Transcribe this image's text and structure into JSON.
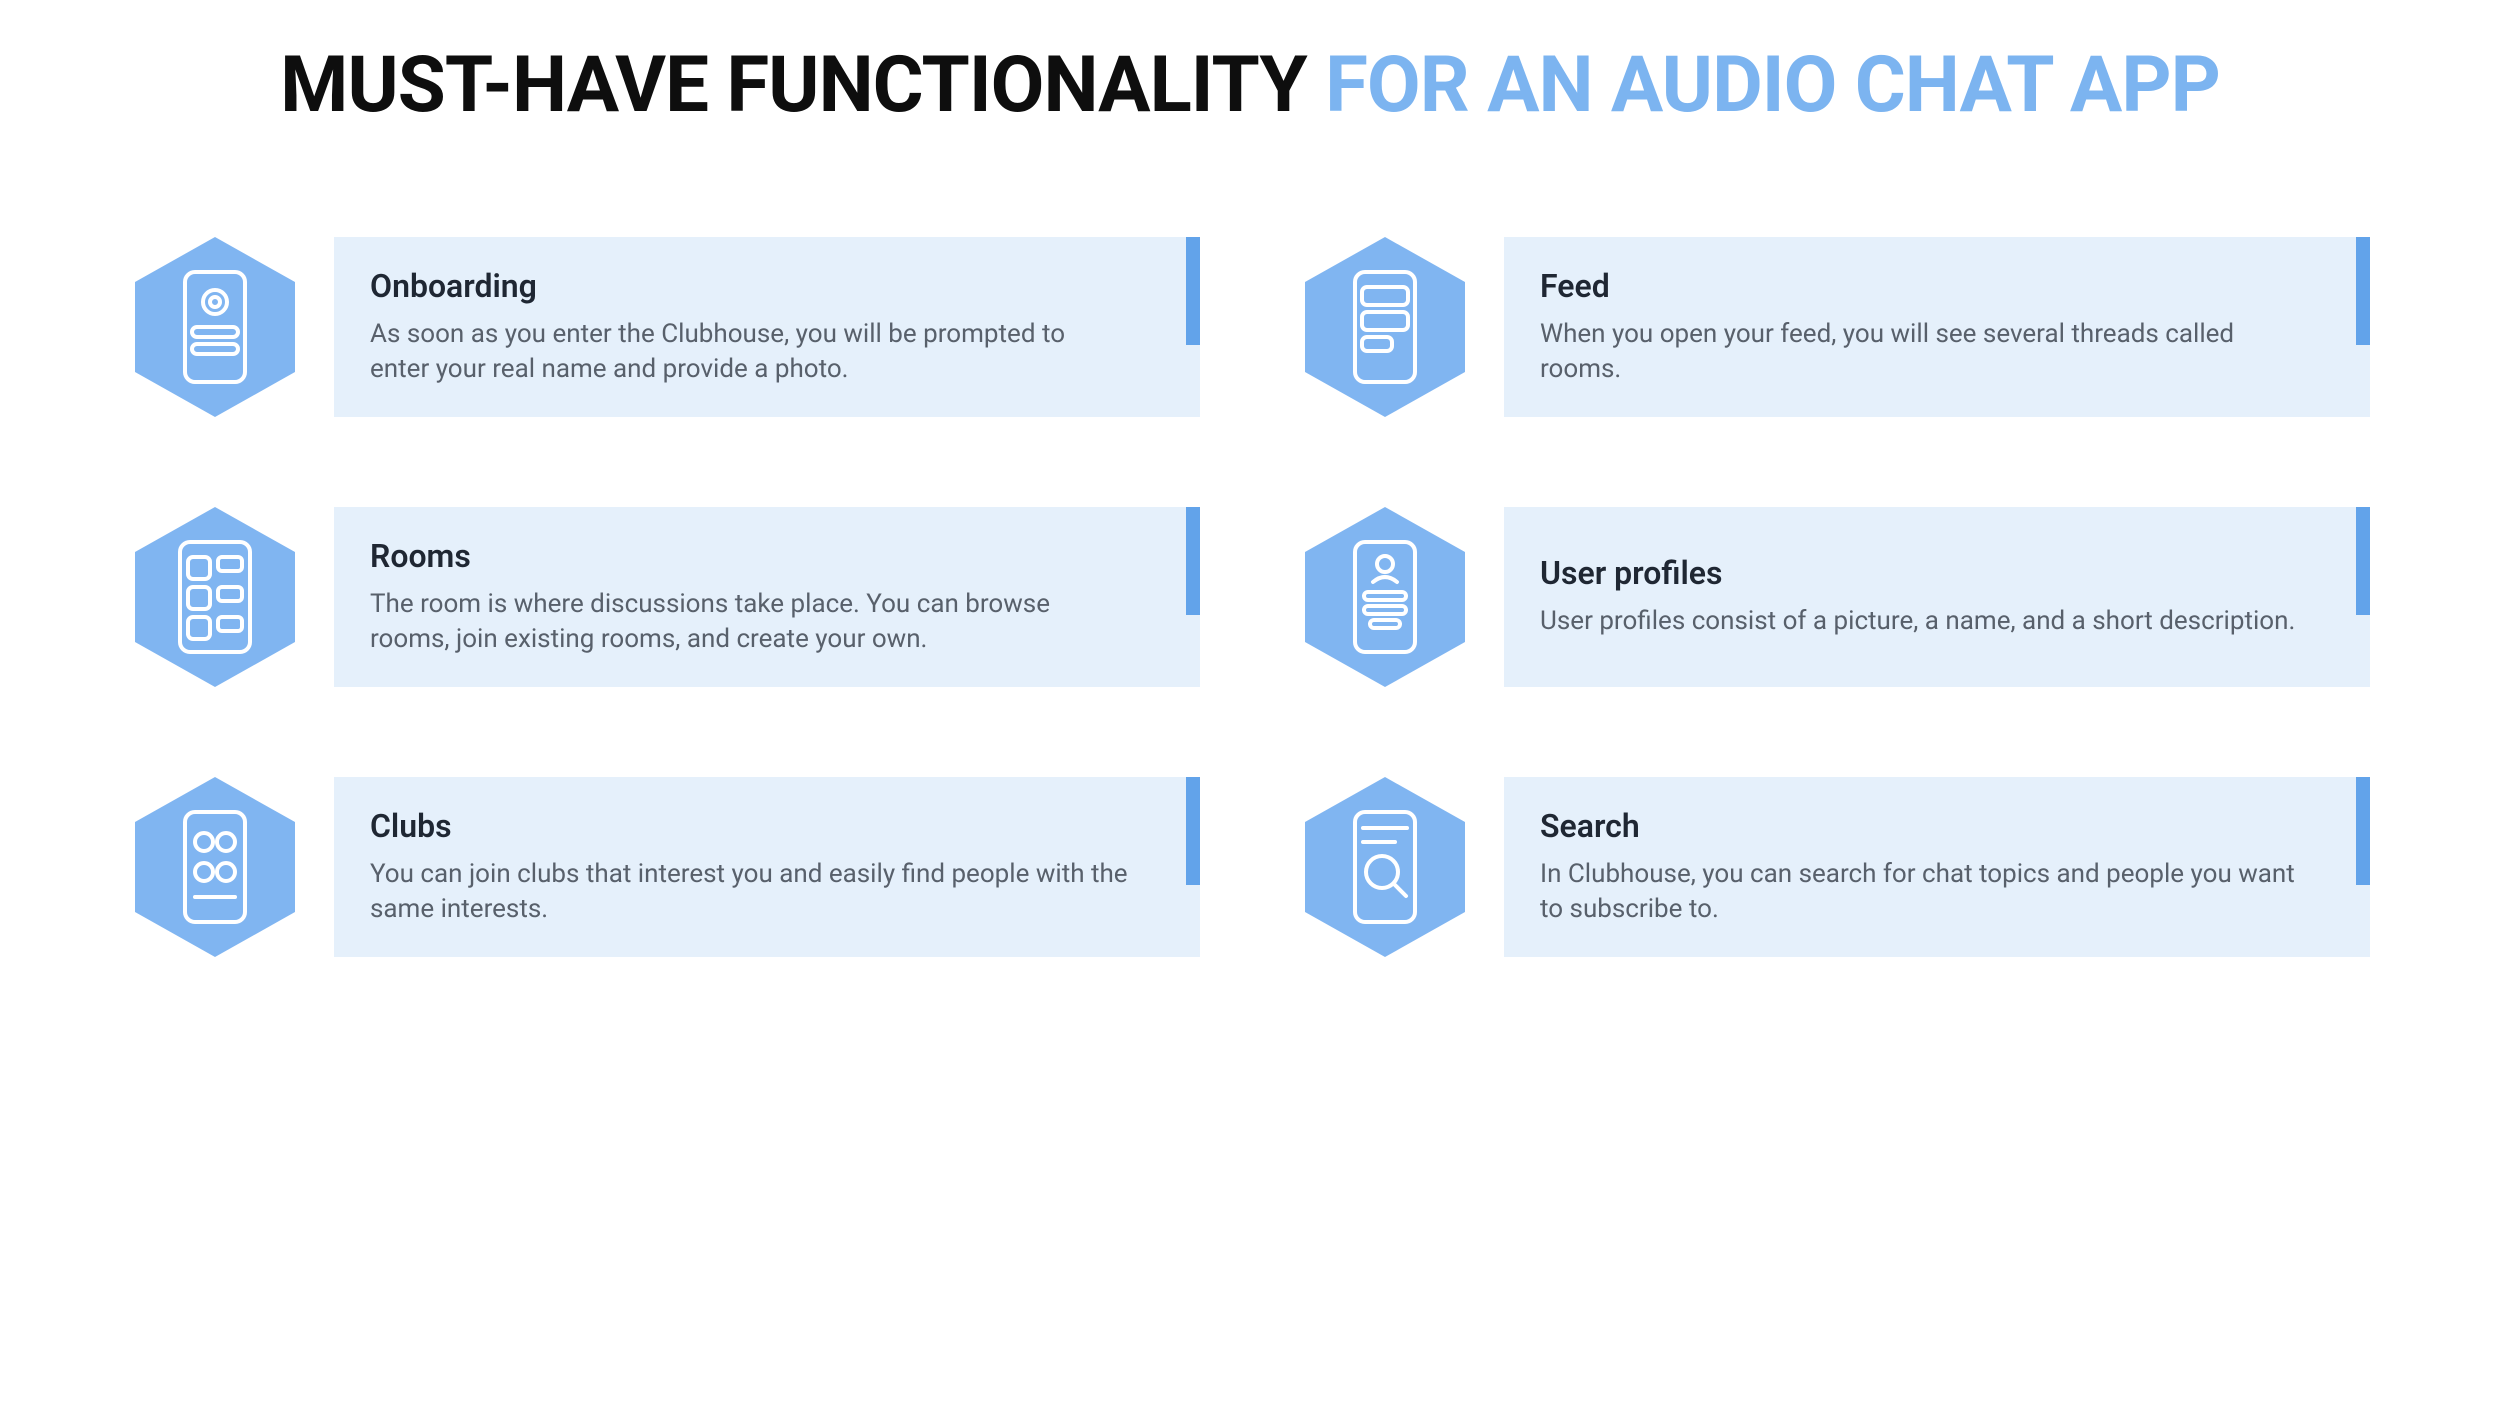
{
  "title": {
    "part1": "MUST-HAVE FUNCTIONALITY ",
    "part2": "FOR AN AUDIO CHAT APP"
  },
  "colors": {
    "hex_fill": "#80b5f1",
    "card_bg": "#e5f0fb",
    "stripe": "#62a3ea",
    "title_blue": "#7cb4f0",
    "title_black": "#0e0e0e"
  },
  "features": [
    {
      "id": "onboarding",
      "icon": "phone-profile-icon",
      "title": "Onboarding",
      "desc": "As soon as you enter the Clubhouse, you will be prompted to enter your real name and provide a photo."
    },
    {
      "id": "feed",
      "icon": "phone-feed-icon",
      "title": "Feed",
      "desc": "When you open your feed, you will see several threads called rooms."
    },
    {
      "id": "rooms",
      "icon": "phone-rooms-icon",
      "title": "Rooms",
      "desc": "The room is where discussions take place. You can browse rooms, join existing rooms, and create your own."
    },
    {
      "id": "user-profiles",
      "icon": "phone-user-icon",
      "title": "User profiles",
      "desc": "User profiles consist of a picture, a name, and a short description."
    },
    {
      "id": "clubs",
      "icon": "phone-clubs-icon",
      "title": "Clubs",
      "desc": "You can join clubs that interest you and easily find people with the same interests."
    },
    {
      "id": "search",
      "icon": "phone-search-icon",
      "title": "Search",
      "desc": "In Clubhouse, you can search for chat topics and people you want to subscribe to."
    }
  ]
}
